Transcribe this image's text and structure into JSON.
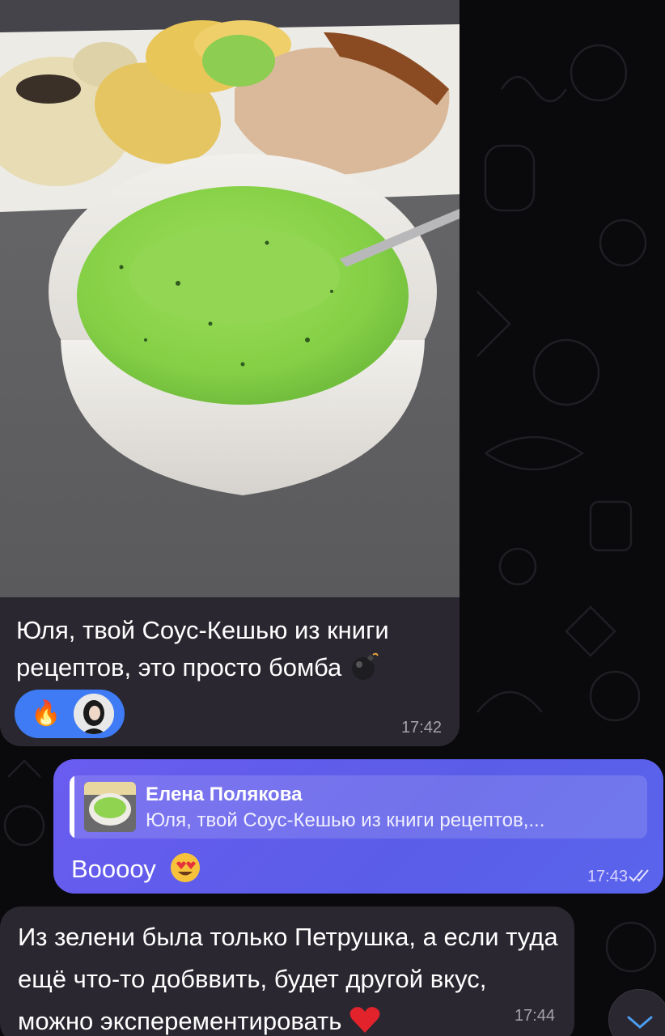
{
  "messages": {
    "photo_message": {
      "caption": "Юля, твой Соус-Кешью из книги рецептов, это просто бомба",
      "caption_emoji": "bomb-emoji",
      "reaction_emoji": "🔥",
      "time": "17:42"
    },
    "reply_message": {
      "quoted_author": "Елена Полякова",
      "quoted_text": "Юля, твой Соус-Кешью из книги рецептов,...",
      "text": "Вооооу",
      "text_emoji": "heart-eyes-emoji",
      "time": "17:43",
      "status": "read"
    },
    "text_message": {
      "text": "Из зелени была только Петрушка, а если туда ещё что-то добввить, будет другой вкус, можно эксперементировать",
      "text_emoji": "red-heart-emoji",
      "time": "17:44"
    }
  },
  "colors": {
    "incoming_bubble": "#2a2730",
    "outgoing_bubble": "#6a5cf0",
    "reaction_pill": "#3e7bf5",
    "background": "#0a0a0c"
  }
}
